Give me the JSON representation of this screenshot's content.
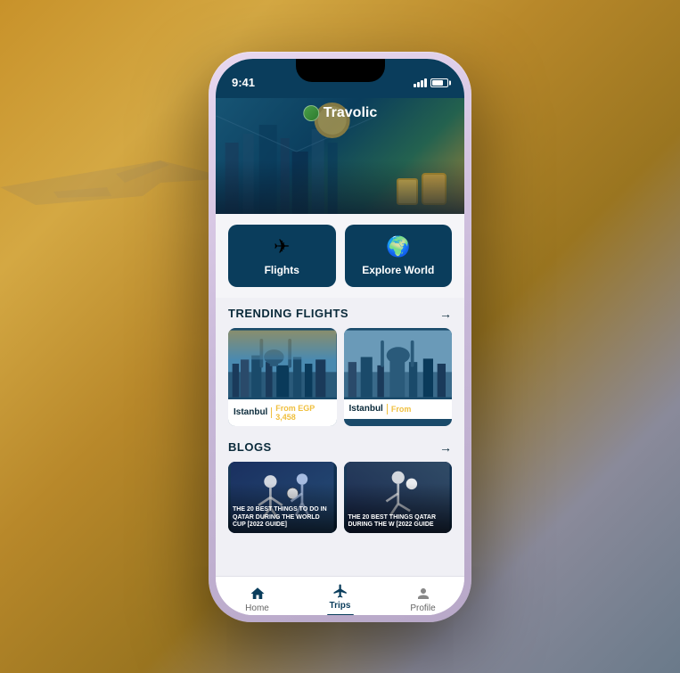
{
  "background": {
    "description": "Blurred airport/city sunset background"
  },
  "phone": {
    "status_bar": {
      "time": "9:41",
      "signal": "signal",
      "battery": "battery"
    },
    "header": {
      "logo_text": "Travolic",
      "logo_icon": "globe-icon"
    },
    "quick_actions": [
      {
        "id": "flights",
        "icon": "✈",
        "label": "Flights",
        "icon_name": "plane-icon"
      },
      {
        "id": "explore",
        "icon": "🌍",
        "label": "Explore World",
        "icon_name": "globe-icon"
      }
    ],
    "sections": {
      "trending_flights": {
        "title": "TRENDING FLIGHTS",
        "arrow": "→",
        "cards": [
          {
            "city": "Istanbul",
            "price": "From EGP 3,458"
          },
          {
            "city": "Istanbul",
            "price": "From"
          }
        ]
      },
      "blogs": {
        "title": "BLOGS",
        "arrow": "→",
        "cards": [
          {
            "title": "THE 20 BEST THINGS TO DO IN QATAR DURING THE WORLD CUP [2022 GUIDE]"
          },
          {
            "title": "THE 20 BEST THINGS QATAR DURING THE W [2022 GUIDE"
          }
        ]
      }
    },
    "bottom_nav": [
      {
        "id": "home",
        "icon": "⊞",
        "label": "Home",
        "active": false,
        "icon_name": "home-icon"
      },
      {
        "id": "trips",
        "icon": "✈",
        "label": "Trips",
        "active": true,
        "icon_name": "trips-icon"
      },
      {
        "id": "profile",
        "icon": "👤",
        "label": "Profile",
        "active": false,
        "icon_name": "profile-icon"
      }
    ]
  }
}
